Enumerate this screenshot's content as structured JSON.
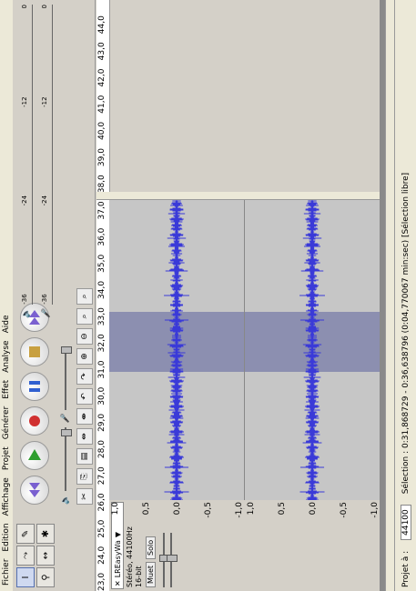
{
  "menu": [
    "Fichier",
    "Edition",
    "Affichage",
    "Projet",
    "Générer",
    "Effet",
    "Analyse",
    "Aide"
  ],
  "tools": [
    "I",
    "✎",
    "↔",
    "🔍",
    "✱",
    "↕"
  ],
  "transport": {
    "buttons": [
      "rewind",
      "play",
      "record",
      "pause",
      "stop",
      "forward"
    ]
  },
  "meters": {
    "labels": [
      "G",
      "D"
    ],
    "scale": [
      "-36",
      "-24",
      "-12",
      "0"
    ]
  },
  "ruler_ticks": [
    "23,0",
    "24,0",
    "25,0",
    "26,0",
    "27,0",
    "28,0",
    "29,0",
    "30,0",
    "31,0",
    "32,0",
    "33,0",
    "34,0",
    "35,0",
    "36,0",
    "37,0",
    "38,0",
    "39,0",
    "40,0",
    "41,0",
    "42,0",
    "43,0",
    "44,0"
  ],
  "track": {
    "name": "LREasyWa",
    "info": [
      "Stéréo, 44100Hz",
      "16-bit"
    ],
    "buttons": [
      "Muet",
      "Solo"
    ],
    "scale_top": [
      "1,0",
      "0,5",
      "0,0",
      "-0,5",
      "-1,0"
    ],
    "scale_bottom": [
      "1,0",
      "0,5",
      "0,0",
      "-0,5",
      "-1,0"
    ],
    "selection_start": 32.0,
    "selection_end": 36.2
  },
  "status": {
    "project_rate_label": "Projet à :",
    "project_rate_value": "44100",
    "selection_text": "Sélection : 0:31,868729 - 0:36,638796 (0:04,770067 min:sec)  [Sélection libre]"
  }
}
